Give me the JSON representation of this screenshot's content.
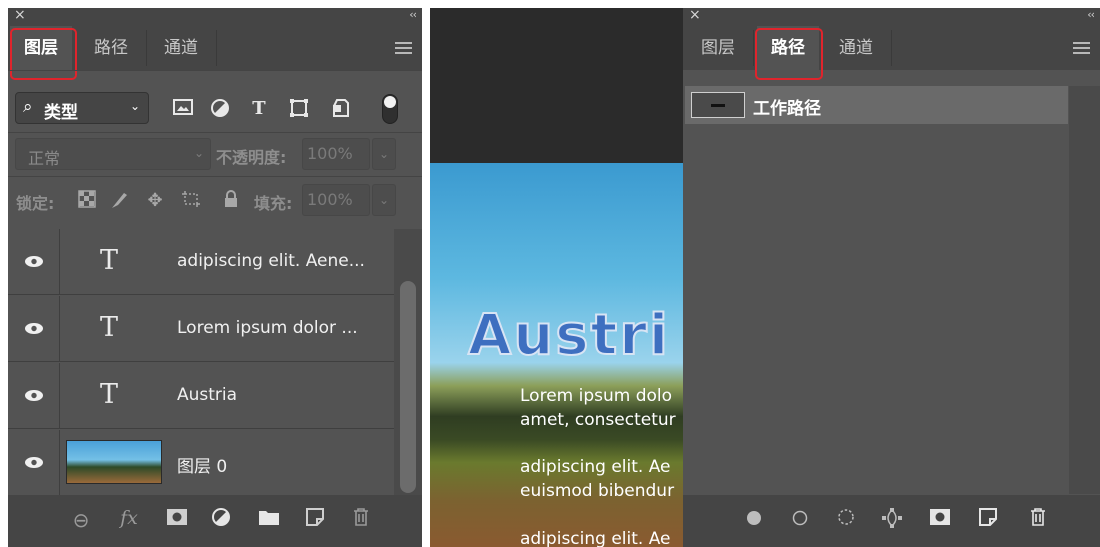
{
  "left_panel": {
    "close_glyph": "×",
    "collapse_glyph": "‹‹",
    "tabs": [
      {
        "label": "图层",
        "active": true
      },
      {
        "label": "路径",
        "active": false
      },
      {
        "label": "通道",
        "active": false
      }
    ],
    "filter": {
      "search_glyph": "⌕",
      "label": "类型",
      "chevron": "⌄"
    },
    "filter_icons": [
      "image-filter-icon",
      "adjustment-filter-icon",
      "type-filter-icon",
      "shape-filter-icon",
      "smart-object-filter-icon"
    ],
    "type_glyph": "T",
    "blend_mode": "正常",
    "opacity_label": "不透明度:",
    "opacity_value": "100%",
    "lock_label": "锁定:",
    "fill_label": "填充:",
    "fill_value": "100%",
    "layers": [
      {
        "name": "adipiscing elit. Aene...",
        "kind": "text",
        "visible": true
      },
      {
        "name": "Lorem ipsum dolor ...",
        "kind": "text",
        "visible": true
      },
      {
        "name": "Austria",
        "kind": "text",
        "visible": true
      },
      {
        "name": "图层 0",
        "kind": "image",
        "visible": true
      }
    ],
    "bottom_icons": [
      "link-layers-icon",
      "fx-icon",
      "layer-mask-icon",
      "adjustment-layer-icon",
      "new-group-icon",
      "new-layer-icon",
      "delete-layer-icon"
    ],
    "fx_label": "fx"
  },
  "canvas": {
    "title_text": "Austri",
    "text_lines": [
      "Lorem ipsum dolo",
      "amet, consectetur",
      "adipiscing elit. Ae",
      "euismod bibendur",
      "adipiscing elit. Ae"
    ]
  },
  "right_panel": {
    "close_glyph": "×",
    "collapse_glyph": "‹‹",
    "tabs": [
      {
        "label": "图层",
        "active": false
      },
      {
        "label": "路径",
        "active": true
      },
      {
        "label": "通道",
        "active": false
      }
    ],
    "paths": [
      {
        "name": "工作路径",
        "selected": true
      }
    ],
    "bottom_icons": [
      "fill-path-icon",
      "stroke-path-icon",
      "load-selection-icon",
      "make-work-path-icon",
      "add-mask-icon",
      "new-path-icon",
      "delete-path-icon"
    ]
  },
  "colors": {
    "panel_bg": "#535353",
    "panel_dark": "#454545",
    "highlight_outline": "#e0242c",
    "selected_row": "#6a6a6a"
  }
}
